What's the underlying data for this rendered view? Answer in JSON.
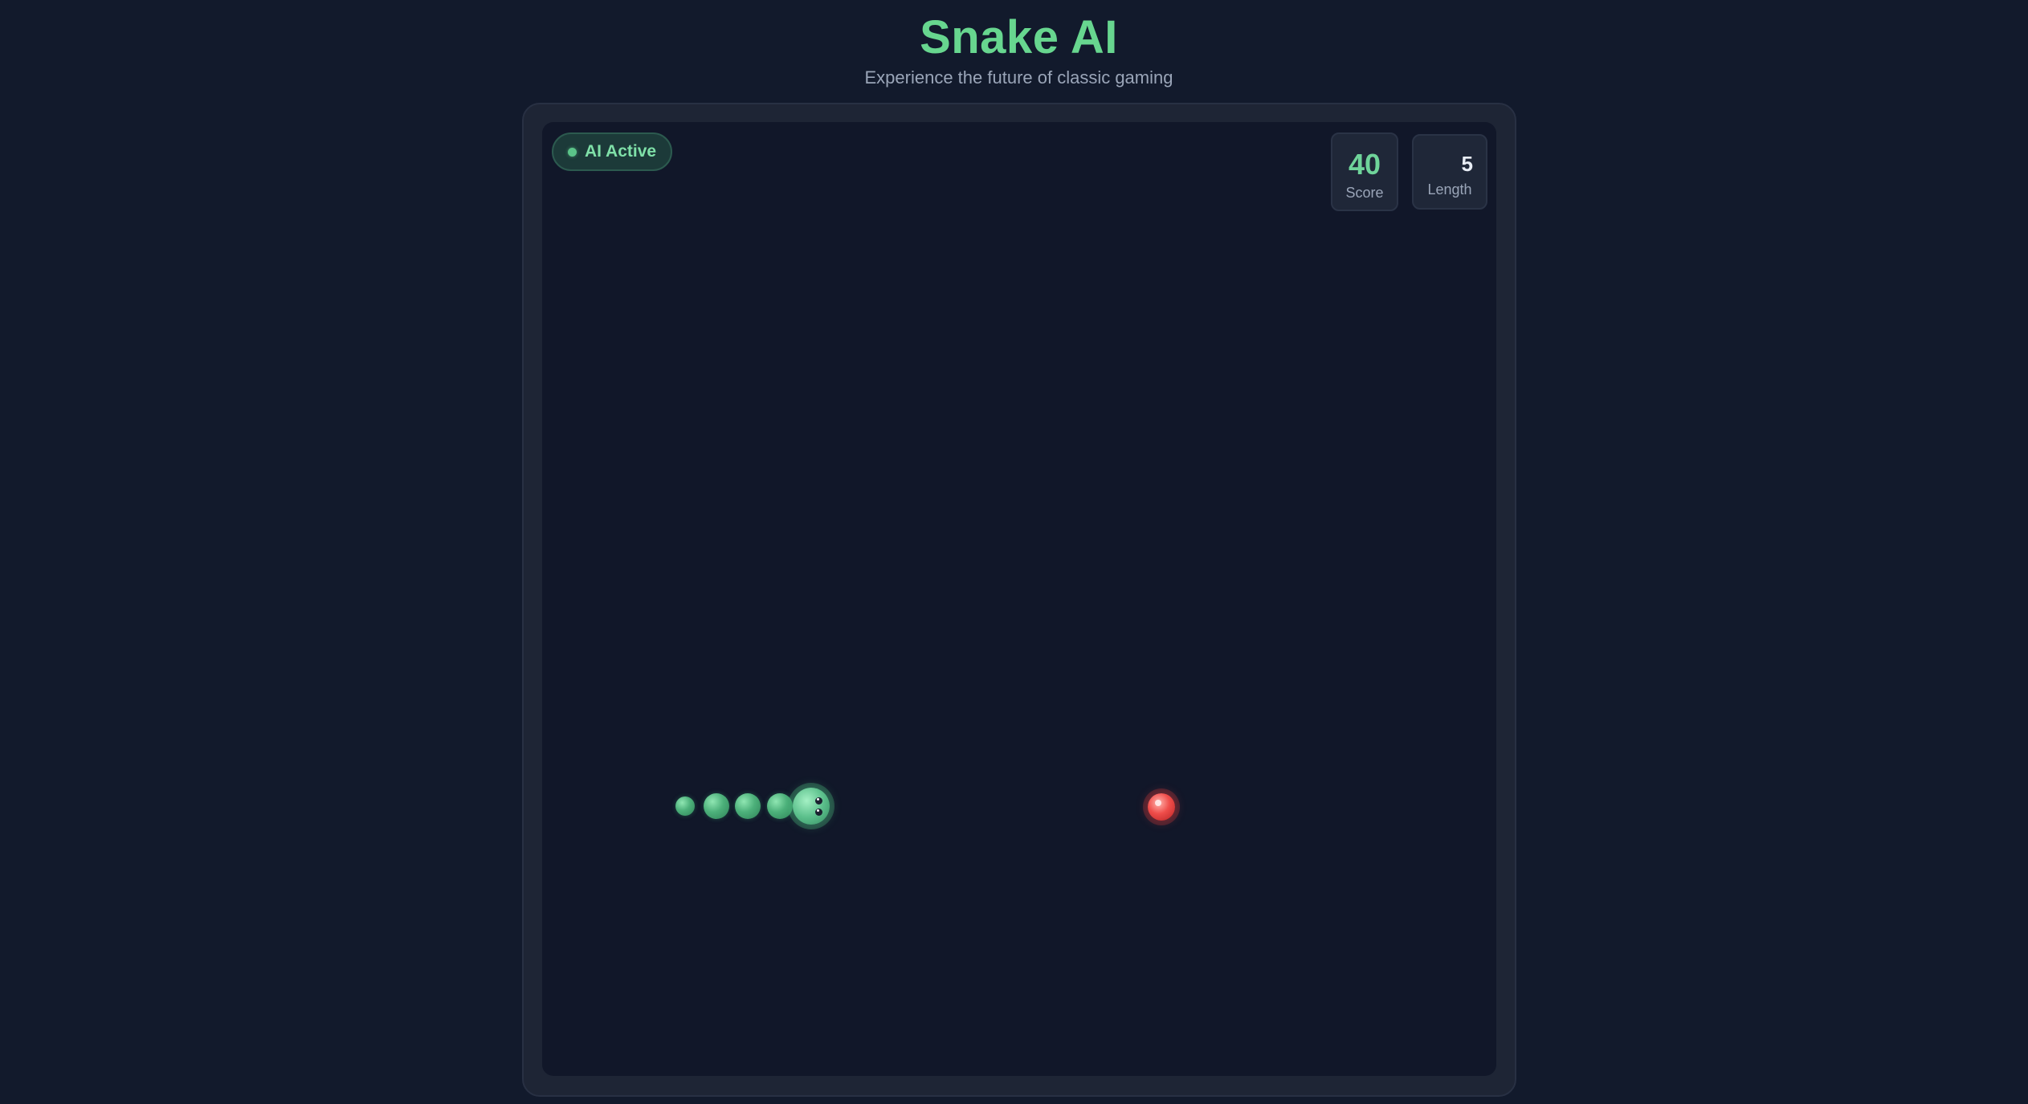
{
  "header": {
    "title": "Snake AI",
    "subtitle": "Experience the future of classic gaming"
  },
  "status": {
    "label": "AI Active",
    "color": "#5bc489"
  },
  "stats": {
    "score_value": "40",
    "score_label": "Score",
    "length_value": "5",
    "length_label": "Length"
  },
  "colors": {
    "background": "#121a2c",
    "board": "#111729",
    "accent": "#67d68f",
    "snake": "#4cb07a",
    "food": "#ef4d4a"
  },
  "game": {
    "direction": "right",
    "snake_length": 5
  }
}
